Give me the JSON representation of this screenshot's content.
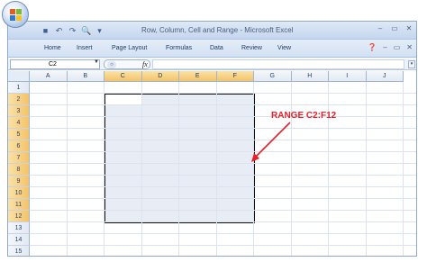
{
  "window": {
    "title": "Row, Column, Cell and Range - Microsoft Excel"
  },
  "quick_access": [
    {
      "icon": "save-icon",
      "glyph": "■"
    },
    {
      "icon": "undo-icon",
      "glyph": "↶"
    },
    {
      "icon": "redo-icon",
      "glyph": "↷"
    },
    {
      "icon": "print-preview-icon",
      "glyph": "🔍"
    },
    {
      "icon": "customize-qat-icon",
      "glyph": "▾"
    }
  ],
  "window_controls": [
    {
      "name": "minimize-button",
      "glyph": "–"
    },
    {
      "name": "restore-button",
      "glyph": "▭"
    },
    {
      "name": "close-button",
      "glyph": "✕"
    }
  ],
  "ribbon": {
    "tabs": [
      "Home",
      "Insert",
      "Page Layout",
      "Formulas",
      "Data",
      "Review",
      "View"
    ],
    "right_controls": [
      {
        "name": "help-icon",
        "glyph": "❓"
      },
      {
        "name": "ribbon-minimize-button",
        "glyph": "–"
      },
      {
        "name": "ribbon-restore-button",
        "glyph": "▭"
      },
      {
        "name": "ribbon-close-button",
        "glyph": "✕"
      }
    ]
  },
  "formula_bar": {
    "name_box": "C2",
    "fx": "fx",
    "formula": ""
  },
  "grid": {
    "columns": [
      "A",
      "B",
      "C",
      "D",
      "E",
      "F",
      "G",
      "H",
      "I",
      "J"
    ],
    "rows": [
      "1",
      "2",
      "3",
      "4",
      "5",
      "6",
      "7",
      "8",
      "9",
      "10",
      "11",
      "12",
      "13",
      "14",
      "15"
    ],
    "selected_columns": [
      "C",
      "D",
      "E",
      "F"
    ],
    "selected_rows": [
      "2",
      "3",
      "4",
      "5",
      "6",
      "7",
      "8",
      "9",
      "10",
      "11",
      "12"
    ],
    "active_cell": "C2"
  },
  "annotation": {
    "label": "RANGE C2:F12",
    "color": "#e8202a"
  },
  "colors": {
    "selection_header": "#f3c36a",
    "range_fill": "#e8edf5",
    "range_border": "#111111"
  }
}
